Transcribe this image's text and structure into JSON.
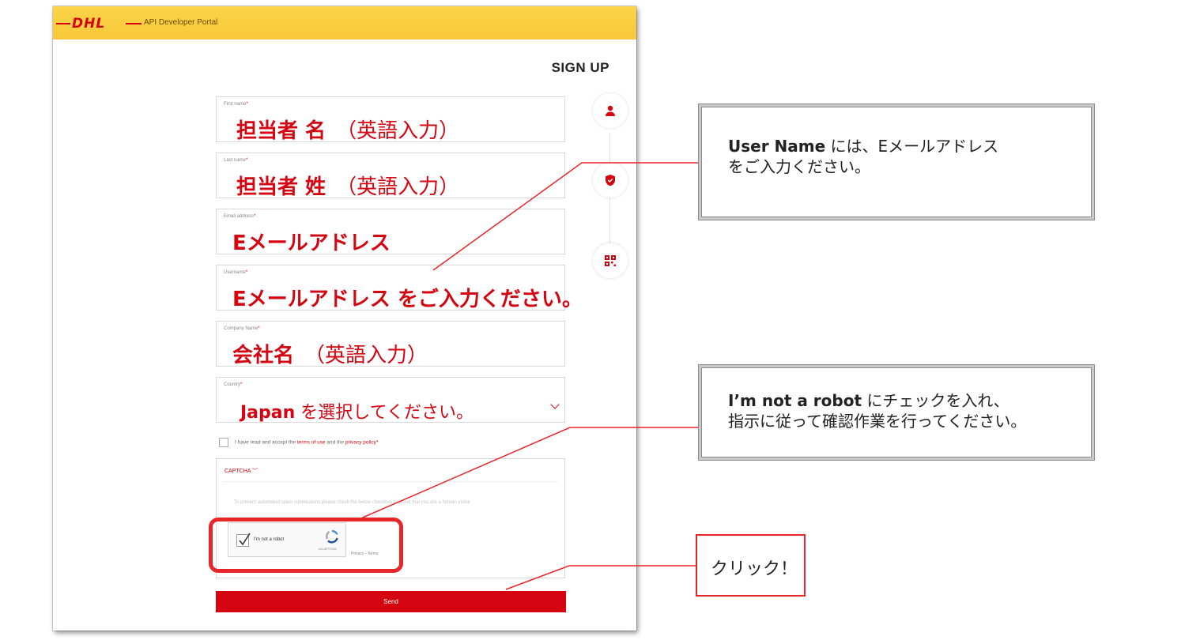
{
  "header": {
    "logo_text": "DHL",
    "portal_title": "API Developer Portal"
  },
  "form": {
    "title": "SIGN UP",
    "fields": [
      {
        "label": "First name",
        "value_bold": "担当者 名",
        "value_normal": "（英語入力）"
      },
      {
        "label": "Last name",
        "value_bold": "担当者 姓",
        "value_normal": "（英語入力）"
      },
      {
        "label": "Email address",
        "value_bold": "Eメールアドレス",
        "value_normal": ""
      },
      {
        "label": "Username",
        "value_bold": "Eメールアドレス をご入力ください。",
        "value_normal": ""
      },
      {
        "label": "Company Name",
        "value_bold": "会社名",
        "value_normal": "（英語入力）"
      },
      {
        "label": "Country",
        "value_bold": "Japan",
        "value_normal": " を選択してください。"
      }
    ],
    "terms": {
      "prefix": "I have read and accept the ",
      "terms_link": "terms of use",
      "middle": " and the ",
      "privacy_link": "privacy policy"
    },
    "captcha": {
      "title": "CAPTCHA",
      "description": "To prevent automated spam submissions please check the below checkbox to prove that you are a human visitor",
      "robot_label": "I'm not a robot",
      "recaptcha_label": "reCAPTCHA",
      "privacy_terms": "Privacy - Terms"
    },
    "send_label": "Send"
  },
  "callouts": {
    "username_bold": "User Name",
    "username_line1_rest": " には、Eメールアドレス",
    "username_line2": "をご入力ください。",
    "robot_bold": "I’m not a robot",
    "robot_line1_rest": " にチェックを入れ、",
    "robot_line2": "指示に従って確認作業を行ってください。",
    "click": "クリック！"
  },
  "colors": {
    "accent": "#d40511",
    "header_yellow": "#fbd448",
    "highlight": "#e8262a"
  }
}
